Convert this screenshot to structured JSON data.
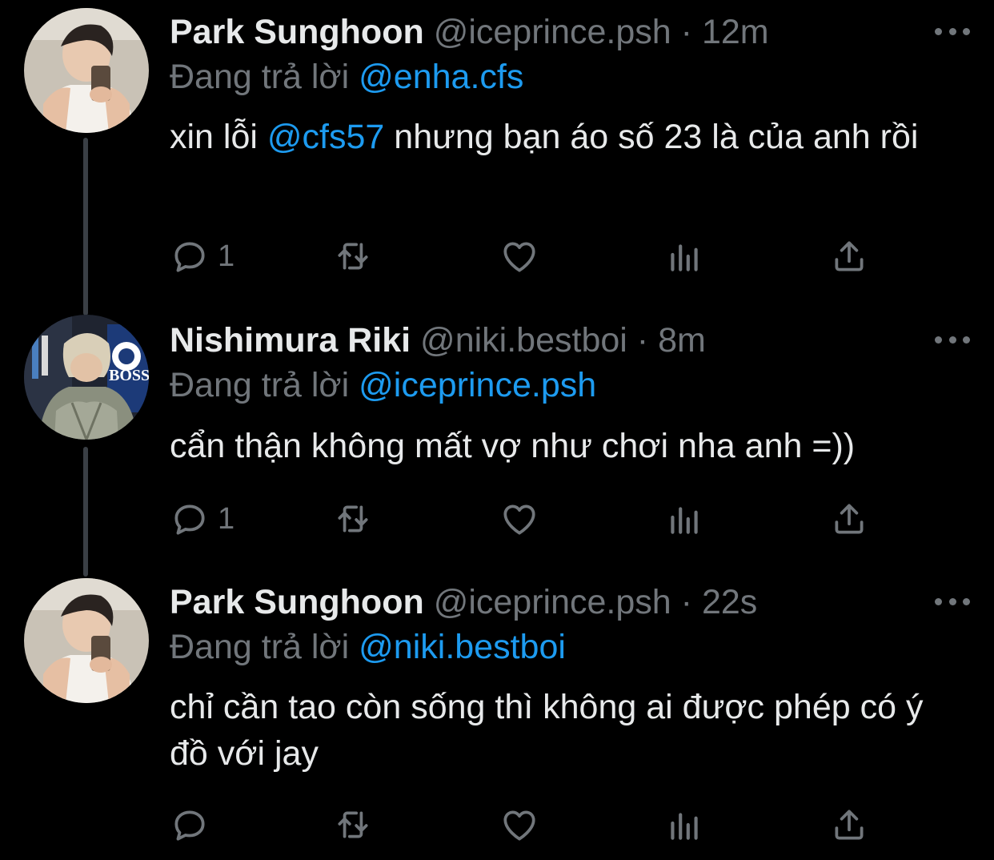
{
  "colors": {
    "background": "#000000",
    "text": "#e7e9ea",
    "muted": "#71767b",
    "link": "#1d9bf0",
    "thread_line": "#3a3f45"
  },
  "tweets": [
    {
      "display_name": "Park Sunghoon",
      "handle": "@iceprince.psh",
      "separator": "·",
      "time": "12m",
      "reply_label": "Đang trả lời",
      "reply_to": "@enha.cfs",
      "text_before": "xin lỗi ",
      "mention": "@cfs57",
      "text_after": " nhưng bạn áo số 23 là của anh rồi",
      "reply_count": "1",
      "avatar_icon": "avatar-photo"
    },
    {
      "display_name": "Nishimura Riki",
      "handle": "@niki.bestboi",
      "separator": "·",
      "time": "8m",
      "reply_label": "Đang trả lời",
      "reply_to": "@iceprince.psh",
      "text": "cẩn thận không mất vợ như chơi nha anh =))",
      "reply_count": "1",
      "avatar_logo_text": "BOSS",
      "avatar_icon": "avatar-photo"
    },
    {
      "display_name": "Park Sunghoon",
      "handle": "@iceprince.psh",
      "separator": "·",
      "time": "22s",
      "reply_label": "Đang trả lời",
      "reply_to": "@niki.bestboi",
      "text": "chỉ cần tao còn sống thì không ai được phép có ý đồ với jay",
      "reply_count": "",
      "avatar_icon": "avatar-photo"
    }
  ],
  "icons": [
    "reply-icon",
    "retweet-icon",
    "like-icon",
    "views-icon",
    "share-icon",
    "more-icon"
  ]
}
